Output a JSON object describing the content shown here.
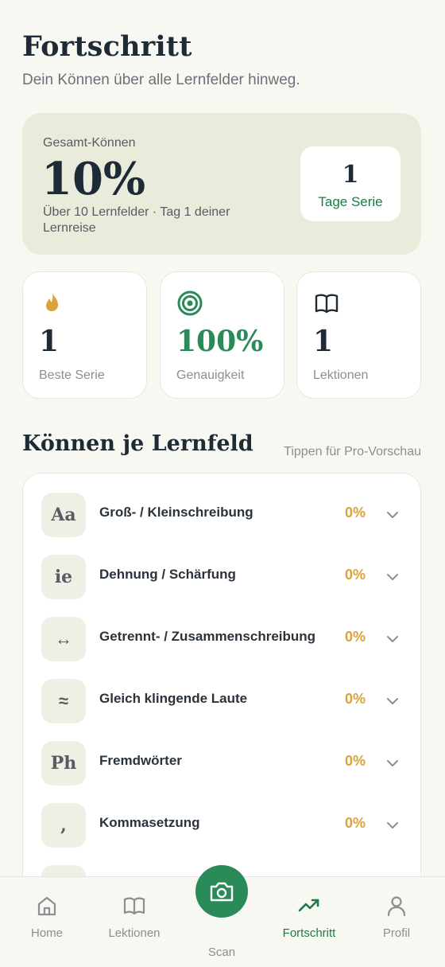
{
  "header": {
    "title": "Fortschritt",
    "subtitle": "Dein Können über alle Lernfelder hinweg."
  },
  "overall": {
    "label": "Gesamt-Können",
    "value": "10%",
    "detail": "Über 10 Lernfelder · Tag 1 deiner Lernreise",
    "streak_value": "1",
    "streak_label": "Tage Serie"
  },
  "stats": [
    {
      "icon": "flame-icon",
      "value": "1",
      "label": "Beste Serie"
    },
    {
      "icon": "target-icon",
      "value": "100%",
      "label": "Genauigkeit"
    },
    {
      "icon": "book-open-icon",
      "value": "1",
      "label": "Lektionen"
    }
  ],
  "section": {
    "title": "Können je Lernfeld",
    "hint": "Tippen für Pro-Vorschau"
  },
  "skills": [
    {
      "badge": "Aa",
      "name": "Groß- / Kleinschreibung",
      "percent": "0%"
    },
    {
      "badge": "ie",
      "name": "Dehnung / Schärfung",
      "percent": "0%"
    },
    {
      "badge": "↔",
      "name": "Getrennt- / Zusammenschreibung",
      "percent": "0%"
    },
    {
      "badge": "≈",
      "name": "Gleich klingende Laute",
      "percent": "0%"
    },
    {
      "badge": "Ph",
      "name": "Fremdwörter",
      "percent": "0%"
    },
    {
      "badge": ",",
      "name": "Kommasetzung",
      "percent": "0%"
    }
  ],
  "nav": {
    "home": "Home",
    "lessons": "Lektionen",
    "scan": "Scan",
    "progress": "Fortschritt",
    "profile": "Profil"
  },
  "colors": {
    "accent_green": "#2a8a58",
    "percent_gold": "#d9a33b",
    "card_tint": "#e9ecdb"
  }
}
